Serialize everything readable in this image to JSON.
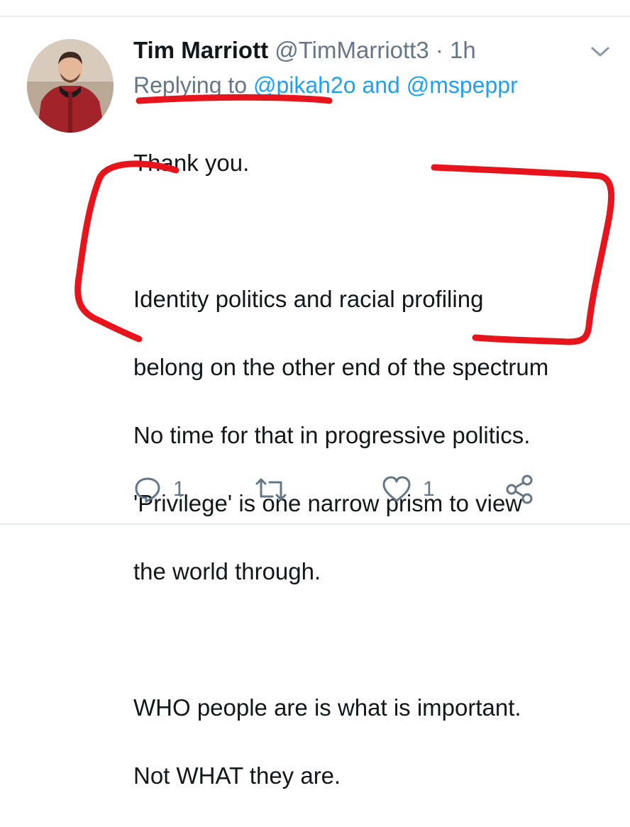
{
  "tweet": {
    "author_name": "Tim Marriott",
    "author_handle": "@TimMarriott3",
    "separator": "·",
    "timestamp": "1h",
    "replying_label": "Replying to",
    "reply_mention_1": "@pikah2o",
    "reply_and": "and",
    "reply_mention_2": "@mspeppr",
    "text_lines": [
      "Thank you.",
      "",
      "Identity politics and racial profiling",
      "belong on the other end of the spectrum",
      "No time for that in progressive politics.",
      "'Privilege'  is one narrow prism to view",
      "the world through.",
      "",
      "WHO people are is what is important.",
      "Not WHAT they are."
    ]
  },
  "actions": {
    "reply_count": "1",
    "like_count": "1"
  },
  "icons": {
    "menu": "chevron-down-icon",
    "reply": "reply-icon",
    "retweet": "retweet-icon",
    "like": "heart-icon",
    "share": "share-icon"
  },
  "colors": {
    "link": "#1da1f2",
    "muted": "#657786",
    "annotation": "#e8141b"
  }
}
